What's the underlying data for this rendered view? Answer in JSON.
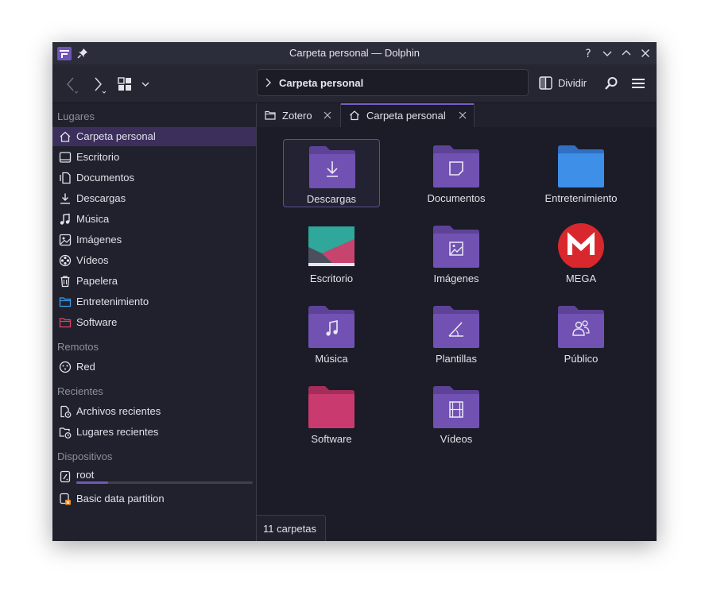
{
  "window": {
    "title": "Carpeta personal — Dolphin"
  },
  "toolbar": {
    "location": "Carpeta personal",
    "split_label": "Dividir"
  },
  "sidebar": {
    "sections": {
      "places": "Lugares",
      "remote": "Remotos",
      "recent": "Recientes",
      "devices": "Dispositivos"
    },
    "places": [
      {
        "label": "Carpeta personal",
        "icon": "home-icon"
      },
      {
        "label": "Escritorio",
        "icon": "desktop-icon"
      },
      {
        "label": "Documentos",
        "icon": "documents-icon"
      },
      {
        "label": "Descargas",
        "icon": "downloads-icon"
      },
      {
        "label": "Música",
        "icon": "music-icon"
      },
      {
        "label": "Imágenes",
        "icon": "pictures-icon"
      },
      {
        "label": "Vídeos",
        "icon": "videos-icon"
      },
      {
        "label": "Papelera",
        "icon": "trash-icon"
      },
      {
        "label": "Entretenimiento",
        "icon": "folder-blue-icon"
      },
      {
        "label": "Software",
        "icon": "folder-red-icon"
      }
    ],
    "remote": [
      {
        "label": "Red",
        "icon": "network-icon"
      }
    ],
    "recent": [
      {
        "label": "Archivos recientes",
        "icon": "recent-files-icon"
      },
      {
        "label": "Lugares recientes",
        "icon": "recent-places-icon"
      }
    ],
    "devices": [
      {
        "label": "root",
        "icon": "drive-icon",
        "usage_fraction": 0.18
      },
      {
        "label": "Basic data partition",
        "icon": "drive-warning-icon"
      }
    ]
  },
  "tabs": [
    {
      "label": "Zotero",
      "icon": "folder-icon"
    },
    {
      "label": "Carpeta personal",
      "icon": "home-icon"
    }
  ],
  "files": [
    {
      "label": "Descargas",
      "icon": "folder-downloads-icon"
    },
    {
      "label": "Documentos",
      "icon": "folder-documents-icon"
    },
    {
      "label": "Entretenimiento",
      "icon": "folder-blue-icon"
    },
    {
      "label": "Escritorio",
      "icon": "desktop-wallpaper-icon"
    },
    {
      "label": "Imágenes",
      "icon": "folder-pictures-icon"
    },
    {
      "label": "MEGA",
      "icon": "mega-logo-icon"
    },
    {
      "label": "Música",
      "icon": "folder-music-icon"
    },
    {
      "label": "Plantillas",
      "icon": "folder-templates-icon"
    },
    {
      "label": "Público",
      "icon": "folder-public-icon"
    },
    {
      "label": "Software",
      "icon": "folder-red-icon"
    },
    {
      "label": "Vídeos",
      "icon": "folder-videos-icon"
    }
  ],
  "status": {
    "text": "11 carpetas"
  },
  "colors": {
    "accent": "#7b5cc9",
    "folder_purple": "#7152b3",
    "folder_blue": "#3d8fe8",
    "folder_red": "#c93b6e",
    "mega_red": "#d9272e"
  }
}
